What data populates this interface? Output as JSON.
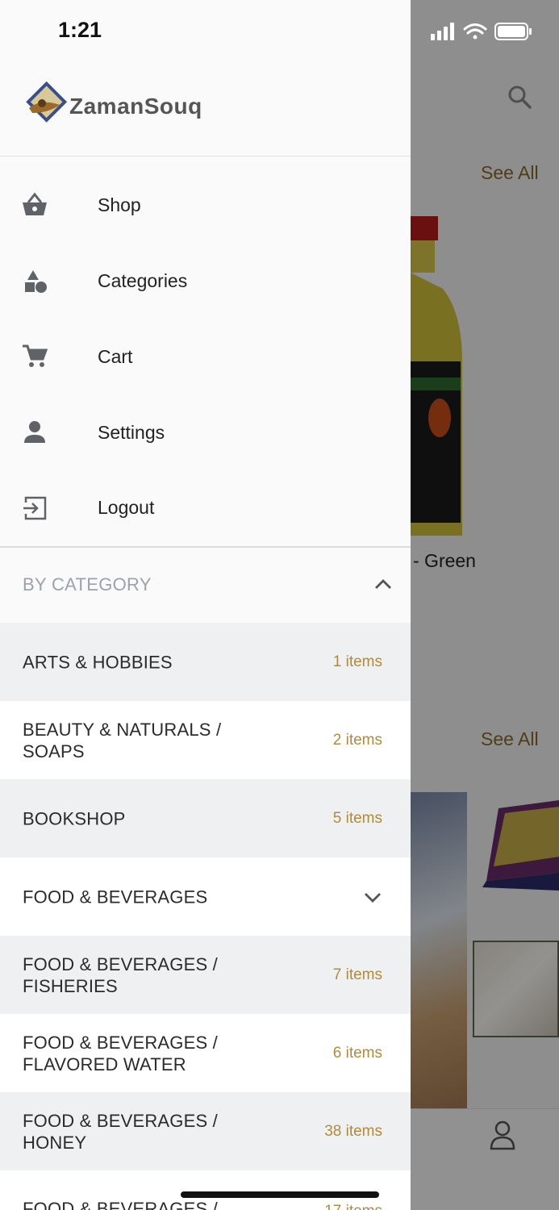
{
  "status_bar": {
    "time": "1:21"
  },
  "brand": {
    "name": "ZamanSouq"
  },
  "background": {
    "see_all_1": "See All",
    "see_all_2": "See All",
    "product_title_fragment": "- Green"
  },
  "menu": {
    "items": [
      {
        "label": "Shop",
        "icon": "basket-icon"
      },
      {
        "label": "Categories",
        "icon": "shapes-icon"
      },
      {
        "label": "Cart",
        "icon": "cart-icon"
      },
      {
        "label": "Settings",
        "icon": "person-icon"
      },
      {
        "label": "Logout",
        "icon": "logout-icon"
      }
    ]
  },
  "category_section": {
    "title": "BY CATEGORY",
    "expanded": true,
    "rows": [
      {
        "name": "ARTS & HOBBIES",
        "count": "1 items"
      },
      {
        "name": "BEAUTY & NATURALS / SOAPS",
        "count": "2 items"
      },
      {
        "name": "BOOKSHOP",
        "count": "5 items"
      },
      {
        "name": "FOOD & BEVERAGES",
        "count": ""
      },
      {
        "name": "FOOD & BEVERAGES / FISHERIES",
        "count": "7 items"
      },
      {
        "name": "FOOD & BEVERAGES / FLAVORED WATER",
        "count": "6 items"
      },
      {
        "name": "FOOD & BEVERAGES / HONEY",
        "count": "38 items"
      },
      {
        "name": "FOOD & BEVERAGES /",
        "count": "17 items"
      }
    ]
  },
  "colors": {
    "accent": "#b08a3e",
    "header_muted": "#9aa3ad",
    "row_shade": "#eef0f1"
  }
}
